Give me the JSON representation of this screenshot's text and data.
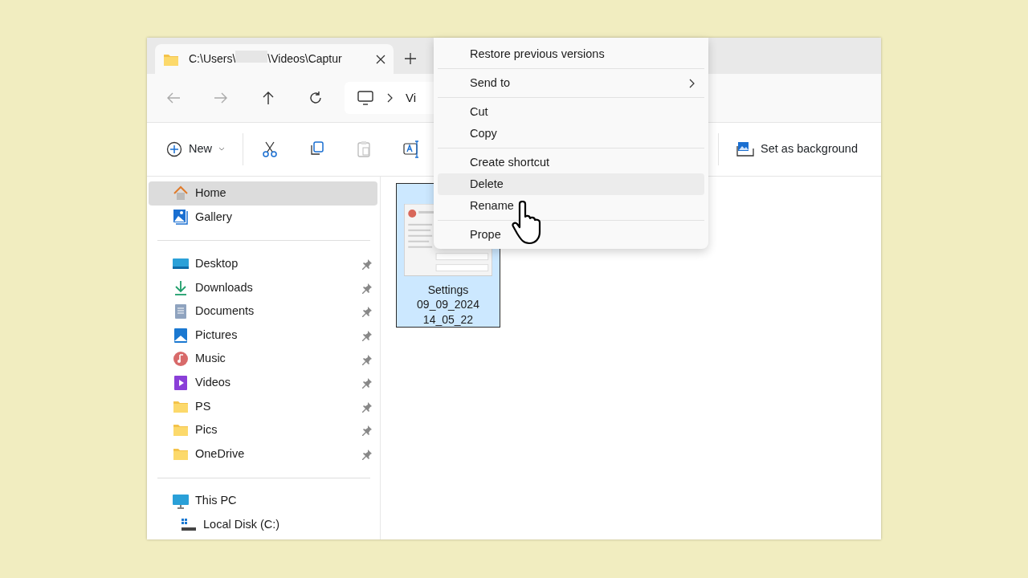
{
  "tab": {
    "path_start": "C:\\Users\\",
    "path_end": "\\Videos\\Captur",
    "redacted": true
  },
  "address": {
    "crumb": "Vi"
  },
  "toolbar": {
    "new_label": "New",
    "background_label": "Set as background"
  },
  "sidebar": {
    "groups": [
      [
        {
          "kind": "home",
          "label": "Home",
          "selected": true,
          "pinned": false
        },
        {
          "kind": "gallery",
          "label": "Gallery",
          "selected": false,
          "pinned": false
        }
      ],
      [
        {
          "kind": "desktop",
          "label": "Desktop",
          "selected": false,
          "pinned": true
        },
        {
          "kind": "downloads",
          "label": "Downloads",
          "selected": false,
          "pinned": true
        },
        {
          "kind": "documents",
          "label": "Documents",
          "selected": false,
          "pinned": true
        },
        {
          "kind": "pictures",
          "label": "Pictures",
          "selected": false,
          "pinned": true
        },
        {
          "kind": "music",
          "label": "Music",
          "selected": false,
          "pinned": true
        },
        {
          "kind": "videos",
          "label": "Videos",
          "selected": false,
          "pinned": true
        },
        {
          "kind": "folder",
          "label": "PS",
          "selected": false,
          "pinned": true
        },
        {
          "kind": "folder",
          "label": "Pics",
          "selected": false,
          "pinned": true
        },
        {
          "kind": "folder",
          "label": "OneDrive",
          "selected": false,
          "pinned": true
        }
      ],
      [
        {
          "kind": "pc",
          "label": "This PC",
          "selected": false,
          "pinned": false,
          "children": [
            {
              "kind": "disk",
              "label": "Local Disk (C:)",
              "selected": false,
              "pinned": false
            }
          ]
        }
      ]
    ]
  },
  "files": [
    {
      "lines": [
        "Settings",
        "09_09_2024",
        "14_05_22"
      ],
      "selected": true
    }
  ],
  "context_menu": {
    "groups": [
      [
        {
          "label": "Restore previous versions",
          "selected": false,
          "submenu": false
        }
      ],
      [
        {
          "label": "Send to",
          "selected": false,
          "submenu": true
        }
      ],
      [
        {
          "label": "Cut",
          "selected": false,
          "submenu": false
        },
        {
          "label": "Copy",
          "selected": false,
          "submenu": false
        }
      ],
      [
        {
          "label": "Create shortcut",
          "selected": false,
          "submenu": false
        },
        {
          "label": "Delete",
          "selected": true,
          "submenu": false
        },
        {
          "label": "Rename",
          "selected": false,
          "submenu": false
        }
      ],
      [
        {
          "label": "Prope",
          "selected": false,
          "submenu": false
        }
      ]
    ]
  },
  "cursor": {
    "kind": "hand"
  }
}
